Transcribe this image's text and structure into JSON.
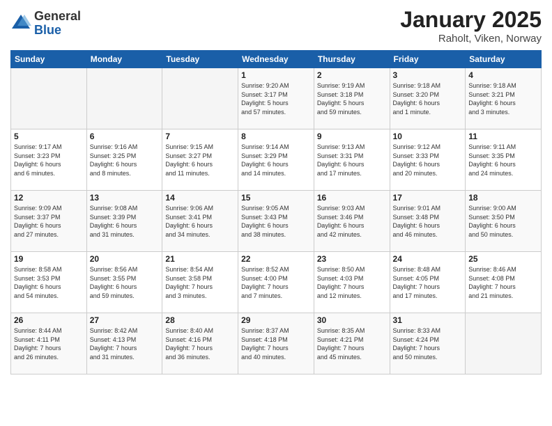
{
  "header": {
    "title": "January 2025",
    "subtitle": "Raholt, Viken, Norway",
    "logo_general": "General",
    "logo_blue": "Blue"
  },
  "weekdays": [
    "Sunday",
    "Monday",
    "Tuesday",
    "Wednesday",
    "Thursday",
    "Friday",
    "Saturday"
  ],
  "weeks": [
    [
      {
        "day": "",
        "info": ""
      },
      {
        "day": "",
        "info": ""
      },
      {
        "day": "",
        "info": ""
      },
      {
        "day": "1",
        "info": "Sunrise: 9:20 AM\nSunset: 3:17 PM\nDaylight: 5 hours\nand 57 minutes."
      },
      {
        "day": "2",
        "info": "Sunrise: 9:19 AM\nSunset: 3:18 PM\nDaylight: 5 hours\nand 59 minutes."
      },
      {
        "day": "3",
        "info": "Sunrise: 9:18 AM\nSunset: 3:20 PM\nDaylight: 6 hours\nand 1 minute."
      },
      {
        "day": "4",
        "info": "Sunrise: 9:18 AM\nSunset: 3:21 PM\nDaylight: 6 hours\nand 3 minutes."
      }
    ],
    [
      {
        "day": "5",
        "info": "Sunrise: 9:17 AM\nSunset: 3:23 PM\nDaylight: 6 hours\nand 6 minutes."
      },
      {
        "day": "6",
        "info": "Sunrise: 9:16 AM\nSunset: 3:25 PM\nDaylight: 6 hours\nand 8 minutes."
      },
      {
        "day": "7",
        "info": "Sunrise: 9:15 AM\nSunset: 3:27 PM\nDaylight: 6 hours\nand 11 minutes."
      },
      {
        "day": "8",
        "info": "Sunrise: 9:14 AM\nSunset: 3:29 PM\nDaylight: 6 hours\nand 14 minutes."
      },
      {
        "day": "9",
        "info": "Sunrise: 9:13 AM\nSunset: 3:31 PM\nDaylight: 6 hours\nand 17 minutes."
      },
      {
        "day": "10",
        "info": "Sunrise: 9:12 AM\nSunset: 3:33 PM\nDaylight: 6 hours\nand 20 minutes."
      },
      {
        "day": "11",
        "info": "Sunrise: 9:11 AM\nSunset: 3:35 PM\nDaylight: 6 hours\nand 24 minutes."
      }
    ],
    [
      {
        "day": "12",
        "info": "Sunrise: 9:09 AM\nSunset: 3:37 PM\nDaylight: 6 hours\nand 27 minutes."
      },
      {
        "day": "13",
        "info": "Sunrise: 9:08 AM\nSunset: 3:39 PM\nDaylight: 6 hours\nand 31 minutes."
      },
      {
        "day": "14",
        "info": "Sunrise: 9:06 AM\nSunset: 3:41 PM\nDaylight: 6 hours\nand 34 minutes."
      },
      {
        "day": "15",
        "info": "Sunrise: 9:05 AM\nSunset: 3:43 PM\nDaylight: 6 hours\nand 38 minutes."
      },
      {
        "day": "16",
        "info": "Sunrise: 9:03 AM\nSunset: 3:46 PM\nDaylight: 6 hours\nand 42 minutes."
      },
      {
        "day": "17",
        "info": "Sunrise: 9:01 AM\nSunset: 3:48 PM\nDaylight: 6 hours\nand 46 minutes."
      },
      {
        "day": "18",
        "info": "Sunrise: 9:00 AM\nSunset: 3:50 PM\nDaylight: 6 hours\nand 50 minutes."
      }
    ],
    [
      {
        "day": "19",
        "info": "Sunrise: 8:58 AM\nSunset: 3:53 PM\nDaylight: 6 hours\nand 54 minutes."
      },
      {
        "day": "20",
        "info": "Sunrise: 8:56 AM\nSunset: 3:55 PM\nDaylight: 6 hours\nand 59 minutes."
      },
      {
        "day": "21",
        "info": "Sunrise: 8:54 AM\nSunset: 3:58 PM\nDaylight: 7 hours\nand 3 minutes."
      },
      {
        "day": "22",
        "info": "Sunrise: 8:52 AM\nSunset: 4:00 PM\nDaylight: 7 hours\nand 7 minutes."
      },
      {
        "day": "23",
        "info": "Sunrise: 8:50 AM\nSunset: 4:03 PM\nDaylight: 7 hours\nand 12 minutes."
      },
      {
        "day": "24",
        "info": "Sunrise: 8:48 AM\nSunset: 4:05 PM\nDaylight: 7 hours\nand 17 minutes."
      },
      {
        "day": "25",
        "info": "Sunrise: 8:46 AM\nSunset: 4:08 PM\nDaylight: 7 hours\nand 21 minutes."
      }
    ],
    [
      {
        "day": "26",
        "info": "Sunrise: 8:44 AM\nSunset: 4:11 PM\nDaylight: 7 hours\nand 26 minutes."
      },
      {
        "day": "27",
        "info": "Sunrise: 8:42 AM\nSunset: 4:13 PM\nDaylight: 7 hours\nand 31 minutes."
      },
      {
        "day": "28",
        "info": "Sunrise: 8:40 AM\nSunset: 4:16 PM\nDaylight: 7 hours\nand 36 minutes."
      },
      {
        "day": "29",
        "info": "Sunrise: 8:37 AM\nSunset: 4:18 PM\nDaylight: 7 hours\nand 40 minutes."
      },
      {
        "day": "30",
        "info": "Sunrise: 8:35 AM\nSunset: 4:21 PM\nDaylight: 7 hours\nand 45 minutes."
      },
      {
        "day": "31",
        "info": "Sunrise: 8:33 AM\nSunset: 4:24 PM\nDaylight: 7 hours\nand 50 minutes."
      },
      {
        "day": "",
        "info": ""
      }
    ]
  ]
}
